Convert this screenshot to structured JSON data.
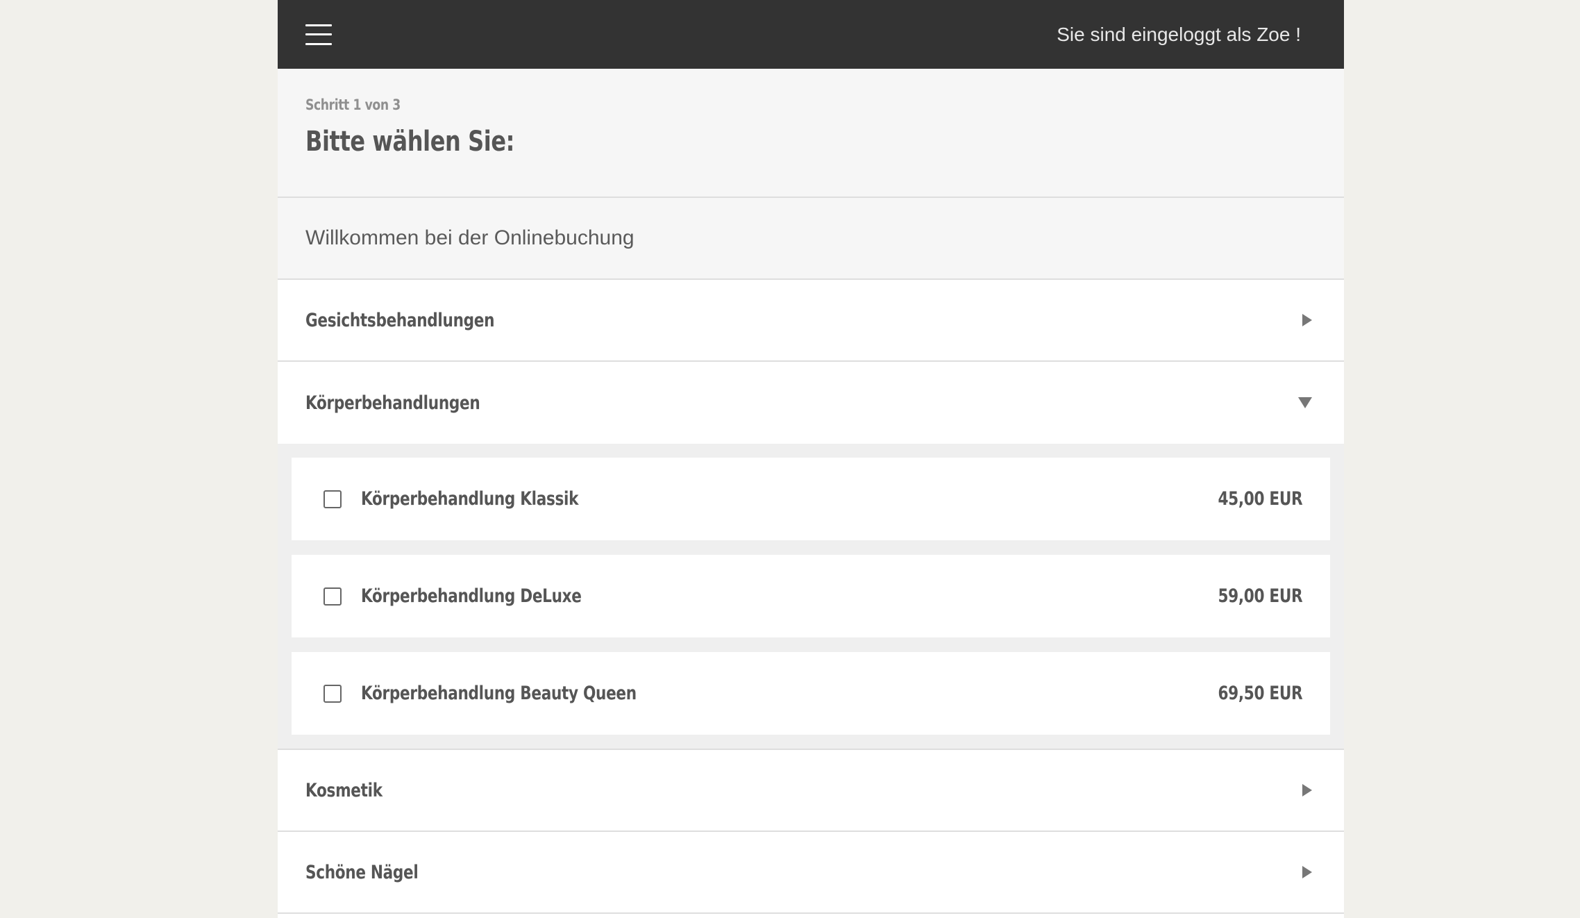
{
  "header": {
    "menu_icon": "hamburger-menu-icon",
    "login_text": "Sie sind eingeloggt als Zoe !"
  },
  "step": {
    "label": "Schritt 1 von 3",
    "title": "Bitte wählen Sie:"
  },
  "welcome": {
    "text": "Willkommen bei der Onlinebuchung"
  },
  "categories": [
    {
      "label": "Gesichtsbehandlungen",
      "state": "collapsed",
      "icon": "triangle-right-icon"
    },
    {
      "label": "Körperbehandlungen",
      "state": "expanded",
      "icon": "triangle-down-icon",
      "items": [
        {
          "label": "Körperbehandlung Klassik",
          "price": "45,00 EUR",
          "checked": false
        },
        {
          "label": "Körperbehandlung DeLuxe",
          "price": "59,00 EUR",
          "checked": false
        },
        {
          "label": "Körperbehandlung Beauty Queen",
          "price": "69,50 EUR",
          "checked": false
        }
      ]
    },
    {
      "label": "Kosmetik",
      "state": "collapsed",
      "icon": "triangle-right-icon"
    },
    {
      "label": "Schöne Nägel",
      "state": "collapsed",
      "icon": "triangle-right-icon"
    }
  ],
  "colors": {
    "header_bg": "#333333",
    "page_bg": "#f1f0eb",
    "text": "#555555",
    "muted_text": "#8f8f8f"
  }
}
